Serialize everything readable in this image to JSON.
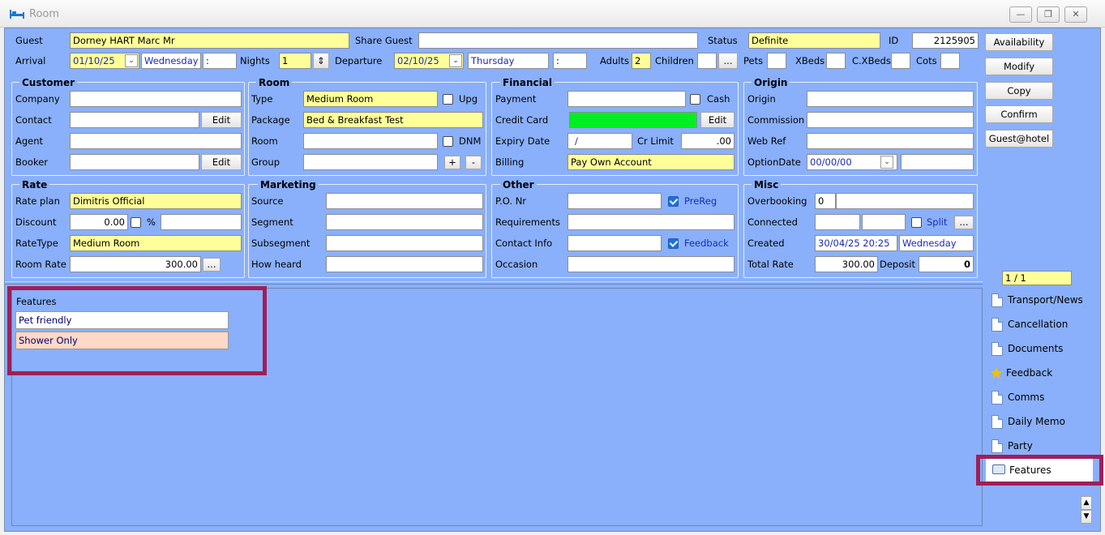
{
  "window": {
    "title": "Room"
  },
  "header": {
    "guest_label": "Guest",
    "guest": "Dorney HART Marc Mr",
    "share_guest_label": "Share Guest",
    "share_guest": "",
    "status_label": "Status",
    "status": "Definite",
    "id_label": "ID",
    "id": "2125905",
    "arrival_label": "Arrival",
    "arrival_date": "01/10/25",
    "arrival_day": "Wednesday",
    "arrival_time": ":",
    "nights_label": "Nights",
    "nights": "1",
    "departure_label": "Departure",
    "departure_date": "02/10/25",
    "departure_day": "Thursday",
    "departure_time": ":",
    "adults_label": "Adults",
    "adults": "2",
    "children_label": "Children",
    "children": "",
    "ellipsis": "...",
    "pets_label": "Pets",
    "pets": "",
    "xbeds_label": "XBeds",
    "xbeds": "",
    "cxbeds_label": "C.XBeds",
    "cxbeds": "",
    "cots_label": "Cots",
    "cots": ""
  },
  "customer": {
    "title": "Customer",
    "company_label": "Company",
    "company": "",
    "contact_label": "Contact",
    "contact": "",
    "agent_label": "Agent",
    "agent": "",
    "booker_label": "Booker",
    "booker": "",
    "edit": "Edit"
  },
  "room": {
    "title": "Room",
    "type_label": "Type",
    "type": "Medium Room",
    "upg": "Upg",
    "package_label": "Package",
    "package": "Bed & Breakfast Test",
    "room_label": "Room",
    "room": "",
    "dnm": "DNM",
    "group_label": "Group",
    "group": "",
    "plus": "+",
    "minus": "-"
  },
  "financial": {
    "title": "Financial",
    "payment_label": "Payment",
    "payment": "",
    "cash": "Cash",
    "credit_card_label": "Credit Card",
    "edit": "Edit",
    "expiry_label": "Expiry Date",
    "expiry": "/",
    "cr_limit_label": "Cr Limit",
    "cr_limit": ".00",
    "billing_label": "Billing",
    "billing": "Pay Own Account"
  },
  "origin": {
    "title": "Origin",
    "origin_label": "Origin",
    "origin": "",
    "commission_label": "Commission",
    "commission": "",
    "webref_label": "Web Ref",
    "webref": "",
    "optiondate_label": "OptionDate",
    "optiondate": "00/00/00",
    "optiondate_extra": ""
  },
  "rate": {
    "title": "Rate",
    "rate_plan_label": "Rate plan",
    "rate_plan": "Dimitris Official",
    "discount_label": "Discount",
    "discount": "0.00",
    "pct": "%",
    "discount_extra": "",
    "ratetype_label": "RateType",
    "ratetype": "Medium Room",
    "room_rate_label": "Room Rate",
    "room_rate": "300.00",
    "ellipsis": "..."
  },
  "marketing": {
    "title": "Marketing",
    "source_label": "Source",
    "source": "",
    "segment_label": "Segment",
    "segment": "",
    "subsegment_label": "Subsegment",
    "subsegment": "",
    "how_heard_label": "How heard",
    "how_heard": ""
  },
  "other": {
    "title": "Other",
    "po_label": "P.O. Nr",
    "po": "",
    "prereg": "PreReg",
    "requirements_label": "Requirements",
    "requirements": "",
    "contact_info_label": "Contact Info",
    "contact_info": "",
    "feedback": "Feedback",
    "occasion_label": "Occasion",
    "occasion": ""
  },
  "misc": {
    "title": "Misc",
    "overbooking_label": "Overbooking",
    "overbooking": "0",
    "connected_label": "Connected",
    "connected_a": "",
    "connected_b": "",
    "split": "Split",
    "ellipsis": "...",
    "created_label": "Created",
    "created": "30/04/25 20:25",
    "created_day": "Wednesday",
    "total_rate_label": "Total Rate",
    "total_rate": "300.00",
    "deposit_label": "Deposit",
    "deposit": "0"
  },
  "side_buttons": {
    "availability": "Availability",
    "modify": "Modify",
    "copy": "Copy",
    "confirm": "Confirm",
    "guest_hotel": "Guest@hotel"
  },
  "pager": "1 / 1",
  "features": {
    "title": "Features",
    "items": [
      {
        "label": "Pet friendly",
        "color": "#ffffff"
      },
      {
        "label": "Shower Only",
        "color": "#ffd8c6"
      }
    ]
  },
  "tabs": [
    "Transport/News",
    "Cancellation",
    "Documents",
    "Feedback",
    "Comms",
    "Daily Memo",
    "Party",
    "Features"
  ],
  "colors": {
    "panel": "#8ab0fb",
    "highlight": "#a01e5a",
    "required": "#ffff9a",
    "credit_card": "#00ee22"
  }
}
